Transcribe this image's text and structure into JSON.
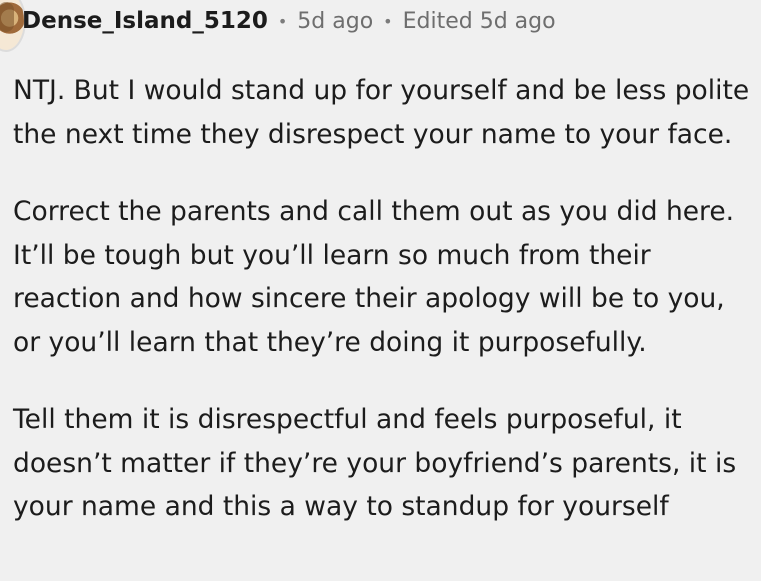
{
  "comment": {
    "author": "Dense_Island_5120",
    "posted": "5d ago",
    "edited": "Edited 5d ago",
    "paragraphs": [
      "NTJ. But I would stand up for yourself and be less polite the next time they disrespect your name to your face.",
      "Correct the parents and call them out as you did here. It’ll be tough but you’ll learn so much from their reaction and how sincere their apology will be to you, or you’ll learn that they’re doing it purposefully.",
      "Tell them it is disrespectful and feels purposeful, it doesn’t matter if they’re your boyfriend’s parents, it is your name and this a way to standup for yourself"
    ]
  }
}
